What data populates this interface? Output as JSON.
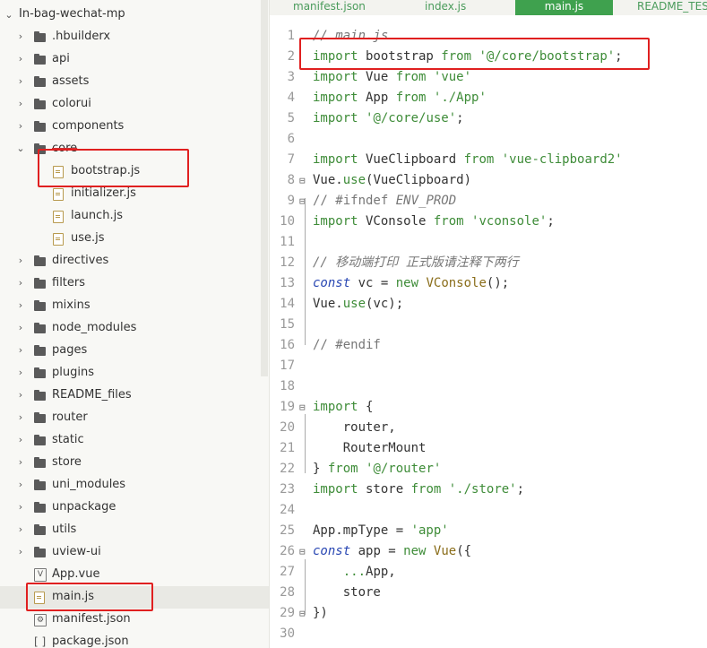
{
  "sidebar": {
    "root": "In-bag-wechat-mp",
    "items": [
      {
        "label": ".hbuilderx",
        "type": "folder"
      },
      {
        "label": "api",
        "type": "folder"
      },
      {
        "label": "assets",
        "type": "folder"
      },
      {
        "label": "colorui",
        "type": "folder"
      },
      {
        "label": "components",
        "type": "folder"
      },
      {
        "label": "core",
        "type": "folder-open"
      },
      {
        "label": "bootstrap.js",
        "type": "file"
      },
      {
        "label": "initializer.js",
        "type": "file"
      },
      {
        "label": "launch.js",
        "type": "file"
      },
      {
        "label": "use.js",
        "type": "file"
      },
      {
        "label": "directives",
        "type": "folder"
      },
      {
        "label": "filters",
        "type": "folder"
      },
      {
        "label": "mixins",
        "type": "folder"
      },
      {
        "label": "node_modules",
        "type": "folder"
      },
      {
        "label": "pages",
        "type": "folder"
      },
      {
        "label": "plugins",
        "type": "folder"
      },
      {
        "label": "README_files",
        "type": "folder"
      },
      {
        "label": "router",
        "type": "folder"
      },
      {
        "label": "static",
        "type": "folder"
      },
      {
        "label": "store",
        "type": "folder"
      },
      {
        "label": "uni_modules",
        "type": "folder"
      },
      {
        "label": "unpackage",
        "type": "folder"
      },
      {
        "label": "utils",
        "type": "folder"
      },
      {
        "label": "uview-ui",
        "type": "folder"
      },
      {
        "label": "App.vue",
        "type": "vue"
      },
      {
        "label": "main.js",
        "type": "file"
      },
      {
        "label": "manifest.json",
        "type": "gear"
      },
      {
        "label": "package.json",
        "type": "json"
      }
    ]
  },
  "tabs": [
    {
      "label": "manifest.json",
      "active": false
    },
    {
      "label": "index.js",
      "active": false
    },
    {
      "label": "main.js",
      "active": true
    },
    {
      "label": "README_TES",
      "active": false
    }
  ],
  "editor": {
    "line_numbers": [
      "1",
      "2",
      "3",
      "4",
      "5",
      "6",
      "7",
      "8",
      "9",
      "10",
      "11",
      "12",
      "13",
      "14",
      "15",
      "16",
      "17",
      "18",
      "19",
      "20",
      "21",
      "22",
      "23",
      "24",
      "25",
      "26",
      "27",
      "28",
      "29",
      "30"
    ],
    "lines": [
      "// main.js",
      "import bootstrap from '@/core/bootstrap';",
      "import Vue from 'vue'",
      "import App from './App'",
      "import '@/core/use';",
      "",
      "import VueClipboard from 'vue-clipboard2'",
      "Vue.use(VueClipboard)",
      "// #ifndef ENV_PROD",
      "import VConsole from 'vconsole';",
      "",
      "// 移动端打印 正式版请注释下两行",
      "const vc = new VConsole();",
      "Vue.use(vc);",
      "",
      "// #endif",
      "",
      "",
      "import {",
      "    router,",
      "    RouterMount",
      "} from '@/router'",
      "import store from './store';",
      "",
      "App.mpType = 'app'",
      "const app = new Vue({",
      "    ...App,",
      "    store",
      "})",
      ""
    ]
  },
  "colors": {
    "active_tab": "#3fa14e",
    "highlight_box": "#e02020",
    "keyword": "#3e8c38"
  }
}
